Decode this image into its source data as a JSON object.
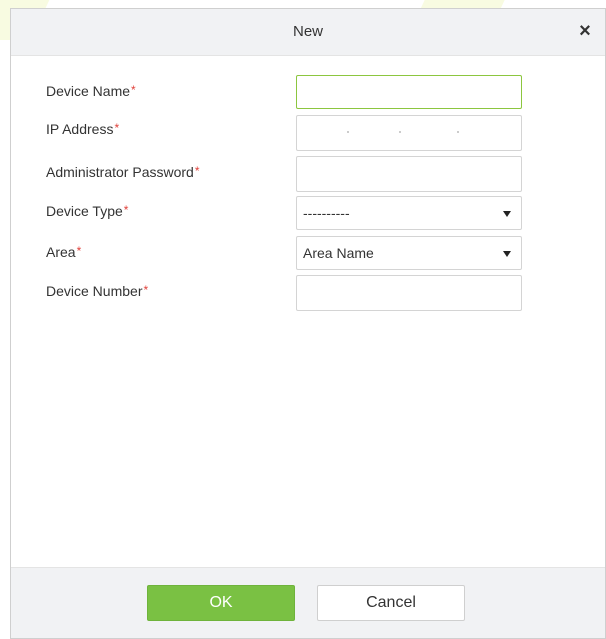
{
  "dialog": {
    "title": "New",
    "close_glyph": "×",
    "close_icon": "close-icon"
  },
  "form": {
    "required_mark": "*",
    "fields": [
      {
        "label": "Device Name",
        "type": "text",
        "value": ""
      },
      {
        "label": "IP Address",
        "type": "ip",
        "value": ""
      },
      {
        "label": "Administrator Password",
        "type": "password",
        "value": ""
      },
      {
        "label": "Device Type",
        "type": "select",
        "value": "----------"
      },
      {
        "label": "Area",
        "type": "select",
        "value": "Area Name"
      },
      {
        "label": "Device Number",
        "type": "text",
        "value": ""
      }
    ]
  },
  "footer": {
    "ok_label": "OK",
    "cancel_label": "Cancel"
  },
  "colors": {
    "accent_green": "#7ac143",
    "focus_border": "#8cc63f",
    "required_red": "#e0403a",
    "header_bg": "#f1f2f4"
  }
}
